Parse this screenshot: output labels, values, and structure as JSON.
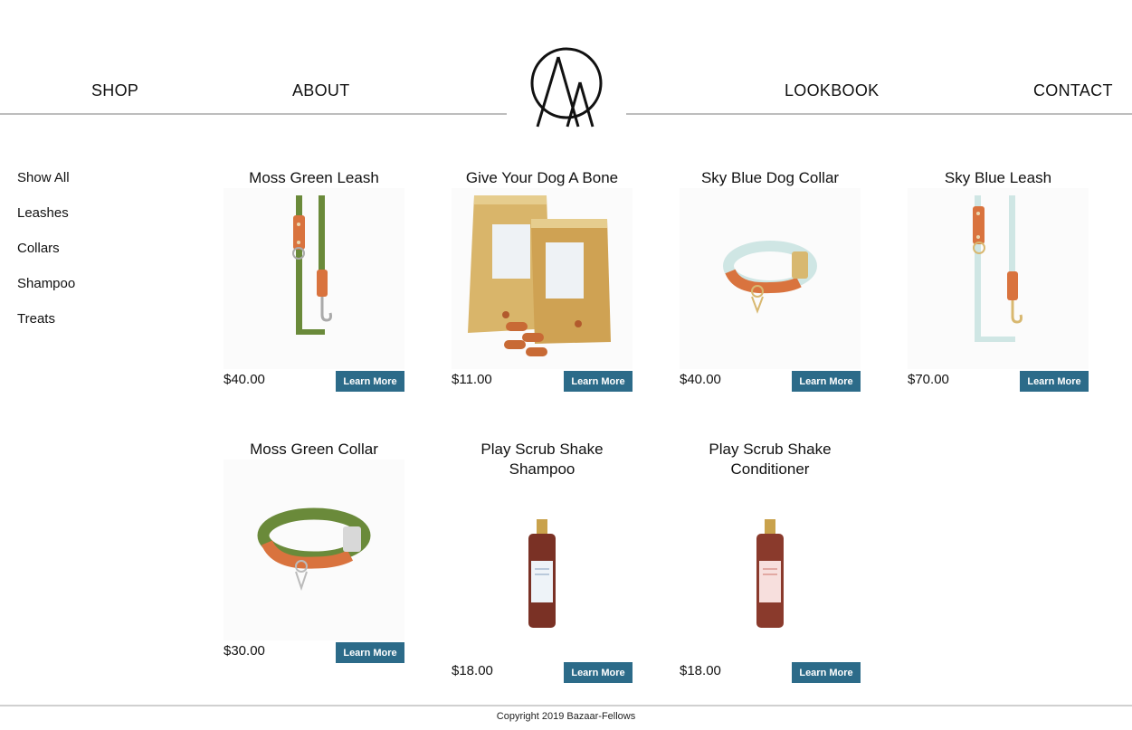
{
  "nav": {
    "shop": "SHOP",
    "about": "ABOUT",
    "lookbook": "LOOKBOOK",
    "contact": "CONTACT"
  },
  "sidebar": {
    "items": [
      {
        "label": "Show All"
      },
      {
        "label": "Leashes"
      },
      {
        "label": "Collars"
      },
      {
        "label": "Shampoo"
      },
      {
        "label": "Treats"
      }
    ]
  },
  "products": [
    {
      "title": "Moss Green Leash",
      "price": "$40.00",
      "button": "Learn More",
      "image": "green-leash"
    },
    {
      "title": "Give Your Dog A Bone",
      "price": "$11.00",
      "button": "Learn More",
      "image": "treat-bags"
    },
    {
      "title": "Sky Blue Dog Collar",
      "price": "$40.00",
      "button": "Learn More",
      "image": "blue-collar"
    },
    {
      "title": "Sky Blue Leash",
      "price": "$70.00",
      "button": "Learn More",
      "image": "blue-leash"
    },
    {
      "title": "Moss Green Collar",
      "price": "$30.00",
      "button": "Learn More",
      "image": "green-collar"
    },
    {
      "title": "Play Scrub Shake Shampoo",
      "price": "$18.00",
      "button": "Learn More",
      "image": "shampoo-bottle"
    },
    {
      "title": "Play Scrub Shake Conditioner",
      "price": "$18.00",
      "button": "Learn More",
      "image": "conditioner-bottle"
    }
  ],
  "colors": {
    "button_bg": "#2c6b89",
    "leather": "#d9733e",
    "moss_green": "#6a8a3a",
    "sky_blue": "#cfe6e4"
  },
  "footer": {
    "copyright": "Copyright 2019 Bazaar-Fellows"
  }
}
